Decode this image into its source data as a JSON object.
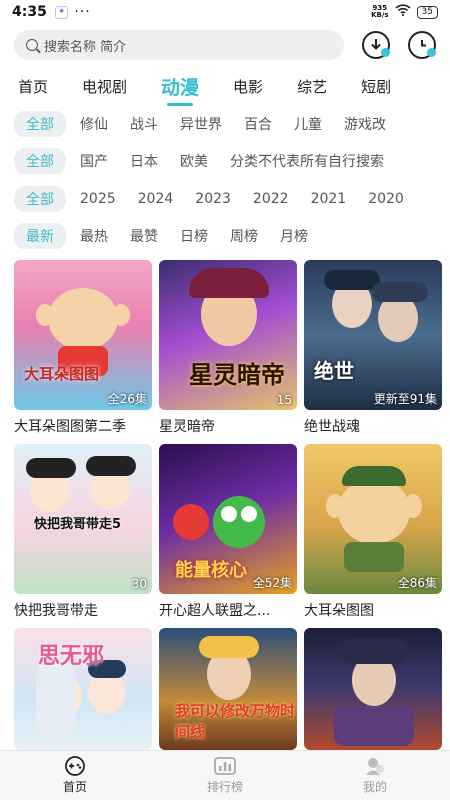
{
  "status": {
    "time": "4:35",
    "net_speed_value": "935",
    "net_speed_unit": "KB/s",
    "battery": "35"
  },
  "search": {
    "placeholder": "搜索名称 简介"
  },
  "tabs": [
    {
      "label": "首页",
      "active": false
    },
    {
      "label": "电视剧",
      "active": false
    },
    {
      "label": "动漫",
      "active": true
    },
    {
      "label": "电影",
      "active": false
    },
    {
      "label": "综艺",
      "active": false
    },
    {
      "label": "短剧",
      "active": false
    }
  ],
  "filters": {
    "genre": [
      "全部",
      "修仙",
      "战斗",
      "异世界",
      "百合",
      "儿童",
      "游戏改"
    ],
    "region": [
      "全部",
      "国产",
      "日本",
      "欧美",
      "分类不代表所有自行搜索"
    ],
    "year": [
      "全部",
      "2025",
      "2024",
      "2023",
      "2022",
      "2021",
      "2020"
    ],
    "sort": [
      "最新",
      "最热",
      "最赞",
      "日榜",
      "周榜",
      "月榜"
    ]
  },
  "items": [
    {
      "title": "大耳朵图图第二季",
      "badge": "全26集",
      "art_text": "大耳朵图图"
    },
    {
      "title": "星灵暗帝",
      "badge": "15",
      "art_text": "星灵暗帝"
    },
    {
      "title": "绝世战魂",
      "badge": "更新至91集",
      "art_text": "绝世"
    },
    {
      "title": "快把我哥带走",
      "badge": "30",
      "art_text": "快把我哥带走5"
    },
    {
      "title": "开心超人联盟之...",
      "badge": "全52集",
      "art_text": "能量核心"
    },
    {
      "title": "大耳朵图图",
      "badge": "全86集",
      "art_text": ""
    },
    {
      "title": "",
      "badge": "",
      "art_text": "思无邪"
    },
    {
      "title": "",
      "badge": "",
      "art_text": "我可以修改万物时间线"
    },
    {
      "title": "",
      "badge": "",
      "art_text": ""
    }
  ],
  "bottom_nav": [
    {
      "label": "首页",
      "icon": "gamepad-icon",
      "active": true
    },
    {
      "label": "排行榜",
      "icon": "chart-icon",
      "active": false
    },
    {
      "label": "我的",
      "icon": "profile-icon",
      "active": false
    }
  ],
  "colors": {
    "accent": "#33bfd0",
    "chip_bg": "#edf0f2"
  }
}
